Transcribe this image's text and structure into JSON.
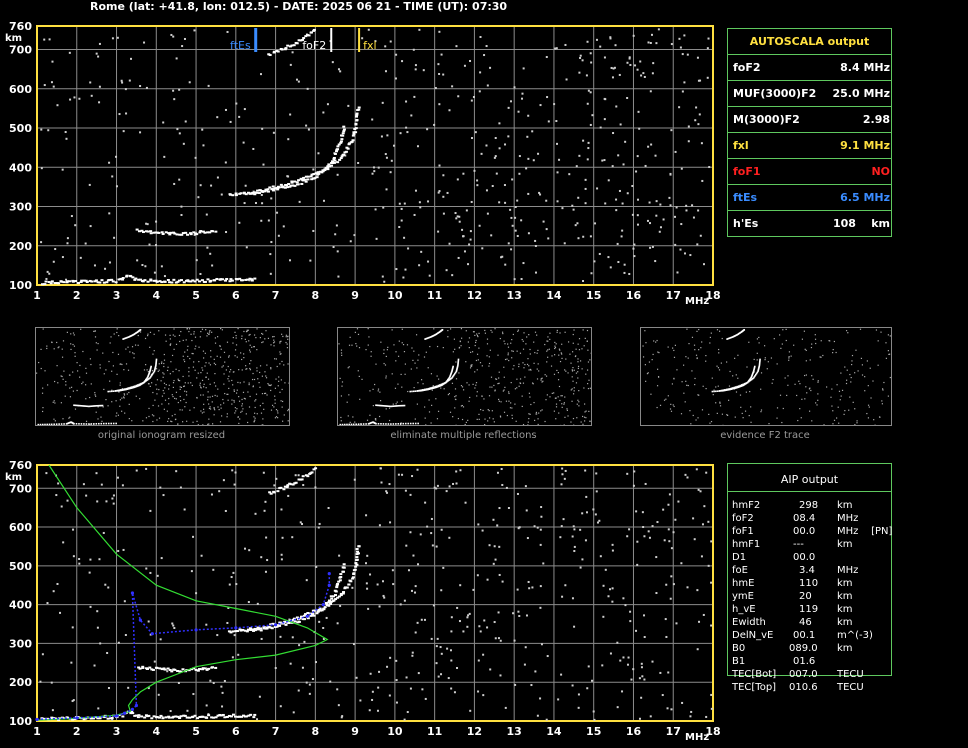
{
  "title": "Rome (lat: +41.8, lon: 012.5) - DATE: 2025 06 21 - TIME (UT): 07:30",
  "axis": {
    "y_unit": "km",
    "x_unit": "MHz"
  },
  "colors": {
    "fxl": "#ffe040",
    "foF1": "#ff2020",
    "ftEs": "#3a8cff",
    "grid": "#8c8c8c",
    "frame": "#ffe040",
    "panel": "#5ec85e"
  },
  "autoscala": {
    "title": "AUTOSCALA output",
    "rows": [
      {
        "key": "foF2",
        "value": "8.4 MHz",
        "color": "#ffffff"
      },
      {
        "key": "MUF(3000)F2",
        "value": "25.0 MHz",
        "color": "#ffffff"
      },
      {
        "key": "M(3000)F2",
        "value": "2.98",
        "color": "#ffffff"
      },
      {
        "key": "fxl",
        "value": "9.1 MHz",
        "color": "#ffe040"
      },
      {
        "key": "foF1",
        "value": "NO",
        "color": "#ff2020"
      },
      {
        "key": "ftEs",
        "value": "6.5 MHz",
        "color": "#3a8cff"
      },
      {
        "key": "h'Es",
        "value": "108    km",
        "color": "#ffffff"
      }
    ]
  },
  "aip": {
    "title": "AIP output",
    "rows": [
      {
        "k": "hmF2",
        "v": "298",
        "u": "km"
      },
      {
        "k": "foF2",
        "v": "08.4",
        "u": "MHz"
      },
      {
        "k": "foF1",
        "v": "00.0",
        "u": "MHz    [PN]"
      },
      {
        "k": "hmF1",
        "v": "---",
        "u": "km"
      },
      {
        "k": "D1",
        "v": "00.0",
        "u": ""
      },
      {
        "k": "foE",
        "v": "3.4",
        "u": "MHz"
      },
      {
        "k": "hmE",
        "v": "110",
        "u": "km"
      },
      {
        "k": "ymE",
        "v": "20",
        "u": "km"
      },
      {
        "k": "h_vE",
        "v": "119",
        "u": "km"
      },
      {
        "k": "Ewidth",
        "v": "46",
        "u": "km"
      },
      {
        "k": "DelN_vE",
        "v": "00.1",
        "u": "m^(-3)"
      },
      {
        "k": "B0",
        "v": "089.0",
        "u": "km"
      },
      {
        "k": "B1",
        "v": "01.6",
        "u": ""
      },
      {
        "k": "TEC[Bot]",
        "v": "007.0",
        "u": "TECU"
      },
      {
        "k": "TEC[Top]",
        "v": "010.6",
        "u": "TECU"
      }
    ]
  },
  "captions": [
    "original ionogram resized",
    "eliminate multiple reflections",
    "evidence F2 trace"
  ],
  "chart_data": [
    {
      "type": "scatter",
      "xlabel": "MHz",
      "ylabel": "km",
      "xlim": [
        1,
        18
      ],
      "ylim": [
        100,
        760
      ],
      "x_ticks": [
        1,
        2,
        3,
        4,
        5,
        6,
        7,
        8,
        9,
        10,
        11,
        12,
        13,
        14,
        15,
        16,
        17,
        18
      ],
      "y_ticks": [
        100,
        200,
        300,
        400,
        500,
        600,
        700,
        760
      ],
      "markers": [
        {
          "name": "ftEs",
          "x": 6.5,
          "color": "#3a8cff"
        },
        {
          "name": "foF2",
          "x": 8.4,
          "color": "#ffffff"
        },
        {
          "name": "fxl",
          "x": 9.1,
          "color": "#ffe040"
        }
      ],
      "series": [
        {
          "name": "Es trace",
          "points": [
            [
              1.1,
              108
            ],
            [
              2,
              110
            ],
            [
              3,
              113
            ],
            [
              3.3,
              125
            ],
            [
              3.5,
              114
            ],
            [
              4.5,
              112
            ],
            [
              5.5,
              115
            ],
            [
              6.5,
              116
            ]
          ]
        },
        {
          "name": "Es multiple",
          "points": [
            [
              3.5,
              240
            ],
            [
              4,
              236
            ],
            [
              4.5,
              232
            ],
            [
              5,
              236
            ],
            [
              5.5,
              238
            ]
          ]
        },
        {
          "name": "F2 trace o",
          "points": [
            [
              5.8,
              333
            ],
            [
              6.5,
              338
            ],
            [
              7,
              347
            ],
            [
              7.5,
              360
            ],
            [
              7.9,
              375
            ],
            [
              8.2,
              395
            ],
            [
              8.45,
              430
            ],
            [
              8.6,
              470
            ],
            [
              8.7,
              510
            ]
          ]
        },
        {
          "name": "F2 trace x",
          "points": [
            [
              6.3,
              338
            ],
            [
              7,
              352
            ],
            [
              7.6,
              370
            ],
            [
              8.2,
              395
            ],
            [
              8.6,
              425
            ],
            [
              8.9,
              470
            ],
            [
              9.0,
              510
            ],
            [
              9.05,
              560
            ]
          ]
        },
        {
          "name": "F2 multiple",
          "points": [
            [
              6.8,
              690
            ],
            [
              7.2,
              705
            ],
            [
              7.5,
              720
            ],
            [
              7.8,
              740
            ],
            [
              8.0,
              756
            ]
          ]
        }
      ]
    },
    {
      "type": "line",
      "xlabel": "MHz",
      "ylabel": "km",
      "xlim": [
        1,
        18
      ],
      "ylim": [
        100,
        760
      ],
      "series": [
        {
          "name": "profile",
          "color": "#33dd33",
          "points": [
            [
              1.3,
              760
            ],
            [
              2,
              650
            ],
            [
              3,
              530
            ],
            [
              4,
              450
            ],
            [
              5,
              410
            ],
            [
              6,
              390
            ],
            [
              7,
              370
            ],
            [
              7.8,
              340
            ],
            [
              8.3,
              310
            ],
            [
              8.0,
              295
            ],
            [
              7,
              270
            ],
            [
              6,
              258
            ],
            [
              5,
              240
            ],
            [
              4.5,
              220
            ],
            [
              4,
              200
            ],
            [
              3.6,
              175
            ],
            [
              3.4,
              155
            ],
            [
              3.3,
              140
            ],
            [
              3.35,
              125
            ],
            [
              3.0,
              115
            ],
            [
              2,
              107
            ],
            [
              1,
              102
            ]
          ]
        },
        {
          "name": "fit",
          "color": "#3030ff",
          "points": [
            [
              1,
              104
            ],
            [
              2,
              108
            ],
            [
              3,
              113
            ],
            [
              3.2,
              120
            ],
            [
              3.4,
              130
            ],
            [
              3.5,
              140
            ],
            [
              3.4,
              430
            ],
            [
              3.6,
              360
            ],
            [
              3.9,
              325
            ],
            [
              5,
              335
            ],
            [
              6,
              340
            ],
            [
              7,
              348
            ],
            [
              7.8,
              370
            ],
            [
              8.2,
              400
            ],
            [
              8.35,
              450
            ],
            [
              8.35,
              480
            ]
          ]
        }
      ]
    }
  ]
}
